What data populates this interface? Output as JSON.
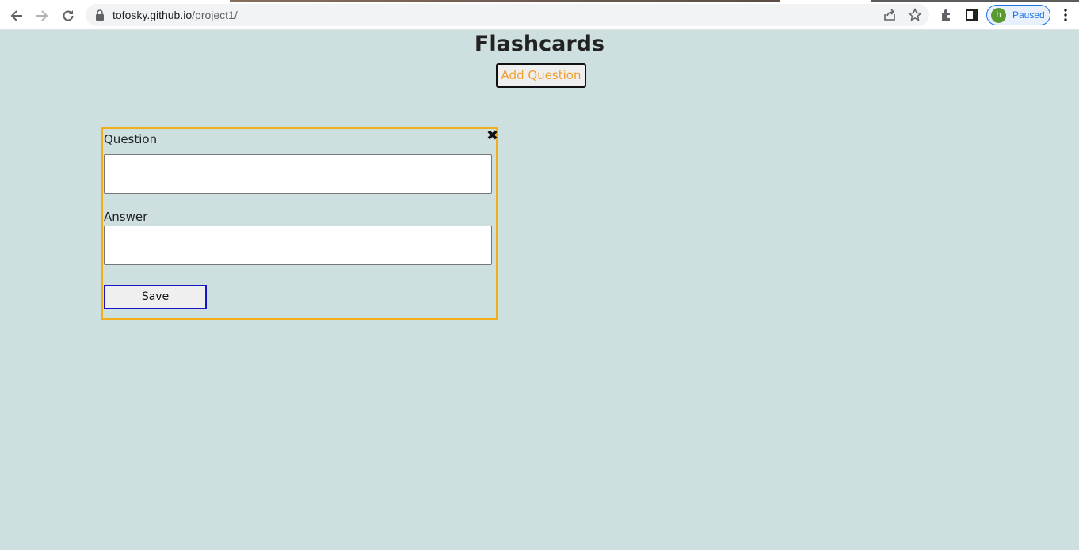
{
  "browser": {
    "url_host": "tofosky.github.io",
    "url_path": "/project1/",
    "profile_initial": "h",
    "profile_status": "Paused",
    "icons": [
      "back-arrow-icon",
      "forward-arrow-icon",
      "reload-icon",
      "lock-icon",
      "share-icon",
      "star-icon",
      "extensions-icon",
      "side-panel-icon",
      "menu-kebab-icon"
    ]
  },
  "page": {
    "title": "Flashcards",
    "add_button": "Add Question"
  },
  "form": {
    "close_symbol": "✖",
    "question_label": "Question",
    "question_value": "",
    "answer_label": "Answer",
    "answer_value": "",
    "save_label": "Save"
  },
  "colors": {
    "page_background": "#cddfdf",
    "card_border": "#f0ad1c",
    "add_button_text": "#f0a030",
    "save_border": "#1616c8"
  }
}
